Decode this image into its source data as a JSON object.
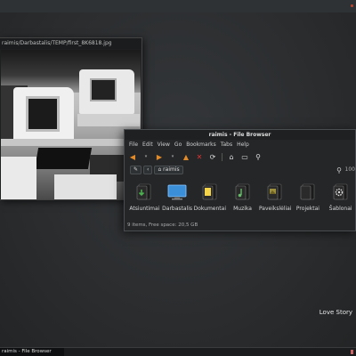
{
  "viewer": {
    "title": "raimis/Darbastalis/TEMP/first_8K6818.jpg"
  },
  "file_browser": {
    "title": "raimis - File Browser",
    "menu": [
      "File",
      "Edit",
      "View",
      "Go",
      "Bookmarks",
      "Tabs",
      "Help"
    ],
    "location": {
      "current": "raimis"
    },
    "zoom_label": "100",
    "files": [
      {
        "label": "Atsiuntimai",
        "icon": "download-folder-icon",
        "color": "#2e7d32"
      },
      {
        "label": "Darbastalis",
        "icon": "desktop-folder-icon",
        "color": "#3b8fd8"
      },
      {
        "label": "Dokumentai",
        "icon": "documents-folder-icon",
        "color": "#e0b92a"
      },
      {
        "label": "Muzika",
        "icon": "music-folder-icon",
        "color": "#43a047"
      },
      {
        "label": "Paveikslėliai",
        "icon": "pictures-folder-icon",
        "color": "#9e8f3a"
      },
      {
        "label": "Projektai",
        "icon": "projects-folder-icon",
        "color": "#555"
      },
      {
        "label": "Šablonai",
        "icon": "templates-folder-icon",
        "color": "#777"
      }
    ],
    "status": "9 items, Free space: 20,5 GB"
  },
  "widget": {
    "text": "Love Story"
  },
  "taskbar": {
    "active_task": "raimis - File Browser"
  },
  "colors": {
    "accent": "#b5452f"
  }
}
